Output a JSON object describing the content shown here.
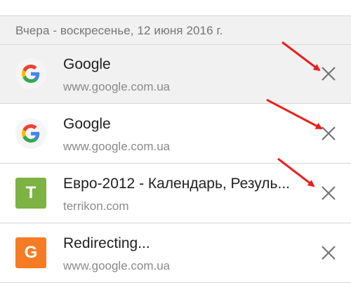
{
  "history": {
    "date_header": "Вчера - воскресенье, 12 июня 2016 г.",
    "items": [
      {
        "title": "Google",
        "url": "www.google.com.ua",
        "favicon": "google-g-icon",
        "favicon_letter": "",
        "favicon_color": ""
      },
      {
        "title": "Google",
        "url": "www.google.com.ua",
        "favicon": "google-g-icon",
        "favicon_letter": "",
        "favicon_color": ""
      },
      {
        "title": "Евро-2012 - Календарь, Резуль...",
        "url": "terrikon.com",
        "favicon": "letter-tile",
        "favicon_letter": "T",
        "favicon_color": "#7cb342"
      },
      {
        "title": "Redirecting...",
        "url": "www.google.com.ua",
        "favicon": "letter-tile",
        "favicon_letter": "G",
        "favicon_color": "#f57c25"
      }
    ],
    "remove_icon": "close-x-icon"
  },
  "annotation": {
    "arrow_color": "#e8201e"
  },
  "colors": {
    "background": "#ffffff",
    "header_background": "#f1f1f1",
    "title_text": "#212121",
    "secondary_text": "#8a8a8a"
  }
}
